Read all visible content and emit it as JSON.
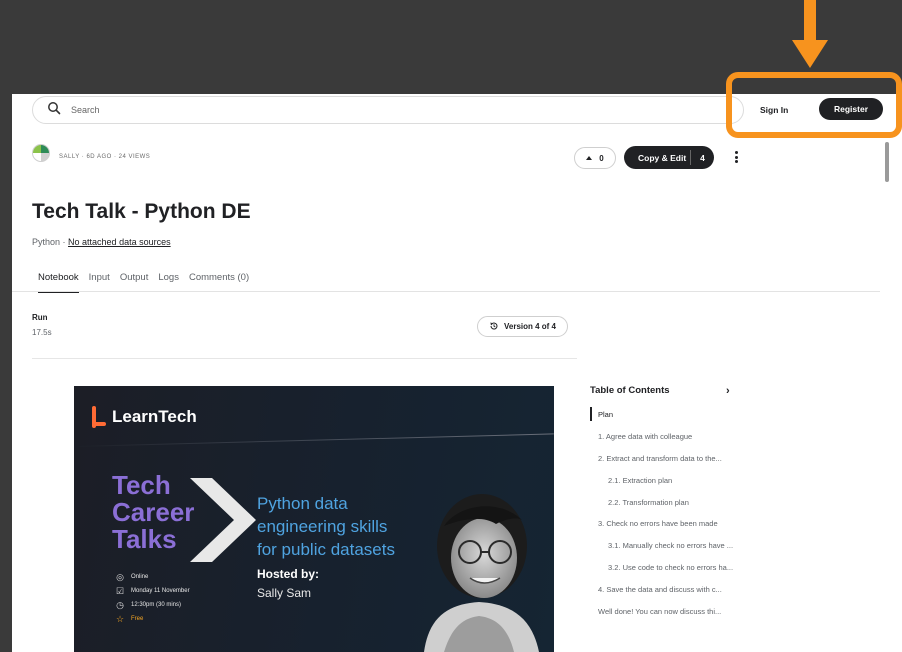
{
  "search": {
    "placeholder": "Search"
  },
  "auth": {
    "sign_in": "Sign In",
    "register": "Register"
  },
  "notebook": {
    "meta": "SALLY · 6D AGO · 24 VIEWS",
    "votes": "0",
    "copy_edit_label": "Copy & Edit",
    "copy_edit_count": "4",
    "title": "Tech Talk - Python DE",
    "language": "Python",
    "separator": " · ",
    "data_sources": "No attached data sources"
  },
  "tabs": [
    "Notebook",
    "Input",
    "Output",
    "Logs",
    "Comments (0)"
  ],
  "run": {
    "label": "Run",
    "time": "17.5s",
    "version": "Version 4 of 4"
  },
  "banner": {
    "brand": "LearnTech",
    "series_line1": "Tech",
    "series_line2": "Career",
    "series_line3": "Talks",
    "headline_line1": "Python data",
    "headline_line2": "engineering skills",
    "headline_line3": "for public datasets",
    "hosted_by": "Hosted by:",
    "host": "Sally Sam",
    "mode": "Online",
    "date": "Monday 11 November",
    "time": "12:30pm (30 mins)",
    "price": "Free"
  },
  "toc": {
    "title": "Table of Contents",
    "items": [
      "Plan",
      "1. Agree data with colleague",
      "2. Extract and transform data to the...",
      "2.1. Extraction plan",
      "2.2. Transformation plan",
      "3. Check no errors have been made",
      "3.1. Manually check no errors have ...",
      "3.2. Use code to check no errors ha...",
      "4. Save the data and discuss with c...",
      "Well done! You can now discuss thi..."
    ]
  },
  "colors": {
    "accent": "#f7931e",
    "dark": "#202124",
    "brand_orange": "#ff6b35",
    "purple": "#8b6fd6",
    "blue": "#4fa3e0"
  }
}
